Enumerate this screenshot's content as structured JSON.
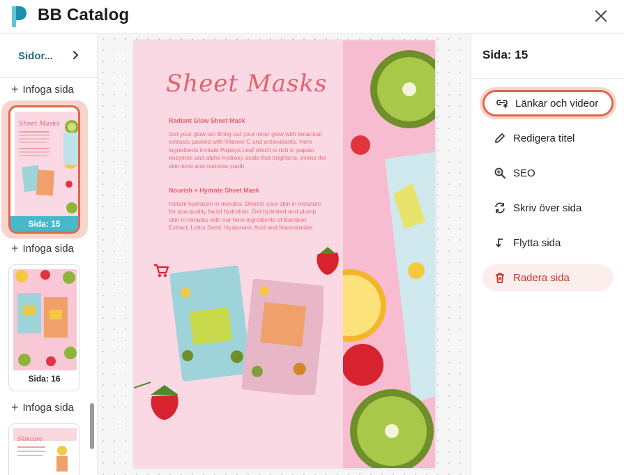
{
  "app": {
    "title": "BB Catalog"
  },
  "colors": {
    "accent": "#e0664a",
    "selected_caption": "#47b8c9",
    "danger": "#c0392b",
    "nav_label": "#2a6f88"
  },
  "sidebar": {
    "label": "Sidor...",
    "insert_label": "Infoga sida",
    "pages": [
      {
        "caption": "Sida: 15",
        "selected": true
      },
      {
        "caption": "Sida: 16",
        "selected": false
      },
      {
        "caption": "",
        "selected": false
      }
    ]
  },
  "page_preview": {
    "title": "Sheet Masks",
    "sections": [
      {
        "heading": "Radiant Glow Sheet Mask",
        "body": "Get your glow on! Bring out your inner glow with botanical extracts packed with Vitamin C and antioxidants. Hero ingredients include Papaya Leaf which is rich in papain enzymes and alpha hydroxy acids that brightens, evens the skin-tone and restores youth."
      },
      {
        "heading": "Nourish + Hydrate Sheet Mask",
        "body": "Instant hydration in minutes. Drench your skin in moisture for spa-quality facial hydration. Get hydrated and plump skin in minutes with our hero ingredients of Bamboo Extract, Lotus Seed, Hyaluronic Acid and Niacinamide."
      }
    ],
    "icons": [
      "cart-icon"
    ]
  },
  "panel": {
    "title": "Sida: 15",
    "actions": [
      {
        "label": "Länkar och videor",
        "icon": "link-icon"
      },
      {
        "label": "Redigera titel",
        "icon": "pencil-icon"
      },
      {
        "label": "SEO",
        "icon": "search-icon"
      },
      {
        "label": "Skriv över sida",
        "icon": "replace-icon"
      },
      {
        "label": "Flytta sida",
        "icon": "move-icon"
      },
      {
        "label": "Radera sida",
        "icon": "trash-icon"
      }
    ]
  }
}
